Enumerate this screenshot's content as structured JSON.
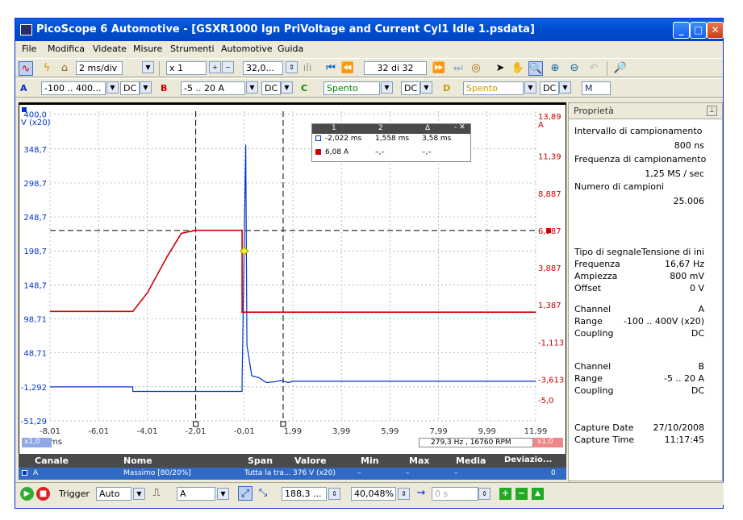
{
  "window": {
    "title": "PicoScope 6 Automotive - [GSXR1000 Ign PriVoltage and Current Cyl1 Idle 1.psdata]",
    "minimize": "_",
    "maximize": "□",
    "close": "✕"
  },
  "menu": [
    "File",
    "Modifica",
    "Videate",
    "Misure",
    "Strumenti",
    "Automotive",
    "Guida"
  ],
  "toolbar1": {
    "timebase": "2 ms/div",
    "zoom": "x 1",
    "samples": "32,0...",
    "buffer": "32 di 32"
  },
  "toolbar2": {
    "a_label": "A",
    "a_range": "-100 .. 400...",
    "a_coupling": "DC",
    "b_label": "B",
    "b_range": "-5 .. 20 A",
    "b_coupling": "DC",
    "c_label": "C",
    "c_range": "Spento",
    "c_coupling": "DC",
    "d_label": "D",
    "d_range": "Spento",
    "d_coupling": "DC",
    "math": "M"
  },
  "colors": {
    "chA": "#0033cc",
    "chB": "#cc0000",
    "ruler_bg": "#ffffff"
  },
  "chart_data": {
    "type": "line",
    "x_ticks": [
      "-8,01",
      "-6,01",
      "-4,01",
      "-2,01",
      "-0,01",
      "1,99",
      "3,99",
      "5,99",
      "7,99",
      "9,99",
      "11,99"
    ],
    "xlabel": "ms",
    "x_zoom": "x1,0",
    "y_left_label": "V (x20)",
    "y_left_ticks": [
      "400,0",
      "348,7",
      "298,7",
      "248,7",
      "198,7",
      "148,7",
      "98,71",
      "48,71",
      "-1,292",
      "-51,29"
    ],
    "y_right_label": "A",
    "y_right_ticks": [
      "13,89",
      "11,39",
      "8,887",
      "6,387",
      "3,887",
      "1,387",
      "-1,113",
      "-3,613",
      "-5,0"
    ],
    "series": [
      {
        "name": "A",
        "color": "#0033cc",
        "x": [
          -8.01,
          -4.6,
          -4.6,
          -0.1,
          -0.1,
          0.05,
          0.1,
          0.3,
          0.6,
          0.9,
          1.2,
          1.5,
          1.8,
          2.0,
          12.0
        ],
        "y": [
          -1.3,
          -1.3,
          -8,
          -8,
          8,
          355,
          60,
          15,
          12,
          5,
          6,
          8,
          5,
          7,
          7
        ]
      },
      {
        "name": "B",
        "color": "#cc0000",
        "x": [
          -8.01,
          -4.6,
          -4.0,
          -3.2,
          -2.6,
          -2.0,
          -0.1,
          -0.1,
          12.0
        ],
        "y": [
          0.95,
          0.95,
          2.2,
          4.6,
          6.2,
          6.4,
          6.4,
          0.9,
          0.9
        ]
      }
    ]
  },
  "rulers": {
    "headers": [
      "1",
      "2",
      "Δ"
    ],
    "row_a": [
      "-2,022 ms",
      "1,558 ms",
      "3,58 ms"
    ],
    "row_b": [
      "6,08 A",
      "–,–",
      "–,–"
    ]
  },
  "freq_readout": "279,3 Hz , 16760 RPM",
  "zoom_right": "x1,0",
  "properties": {
    "header": "Proprietà",
    "sampling_interval_label": "Intervallo di campionamento",
    "sampling_interval": "800 ns",
    "sampling_rate_label": "Frequenza di campionamento",
    "sampling_rate": "1,25 MS / sec",
    "num_samples_label": "Numero di campioni",
    "num_samples": "25.006",
    "signal_type_label": "Tipo di segnale",
    "signal_type": "Tensione di ini",
    "frequency_label": "Frequenza",
    "frequency": "16,67 Hz",
    "amplitude_label": "Ampiezza",
    "amplitude": "800 mV",
    "offset_label": "Offset",
    "offset": "0 V",
    "ch1_label": "Channel",
    "ch1": "A",
    "range1_label": "Range",
    "range1": "-100 .. 400V (x20)",
    "coupling1_label": "Coupling",
    "coupling1": "DC",
    "ch2_label": "Channel",
    "ch2": "B",
    "range2_label": "Range",
    "range2": "-5 .. 20 A",
    "coupling2_label": "Coupling",
    "coupling2": "DC",
    "capture_date_label": "Capture Date",
    "capture_date": "27/10/2008",
    "capture_time_label": "Capture Time",
    "capture_time": "11:17:45"
  },
  "measurements": {
    "headers": [
      "Canale",
      "Nome",
      "Span",
      "Valore",
      "Min",
      "Max",
      "Media",
      "Deviazio..."
    ],
    "row": [
      "A",
      "Massimo [80/20%]",
      "Tutta la tra...",
      "376 V (x20)",
      "–",
      "–",
      "–",
      "0"
    ]
  },
  "status": {
    "trigger_label": "Trigger",
    "trigger_mode": "Auto",
    "trigger_source": "A",
    "trigger_level": "188,3 ...",
    "pretrigger": "40,048%",
    "delay": "0 s"
  }
}
